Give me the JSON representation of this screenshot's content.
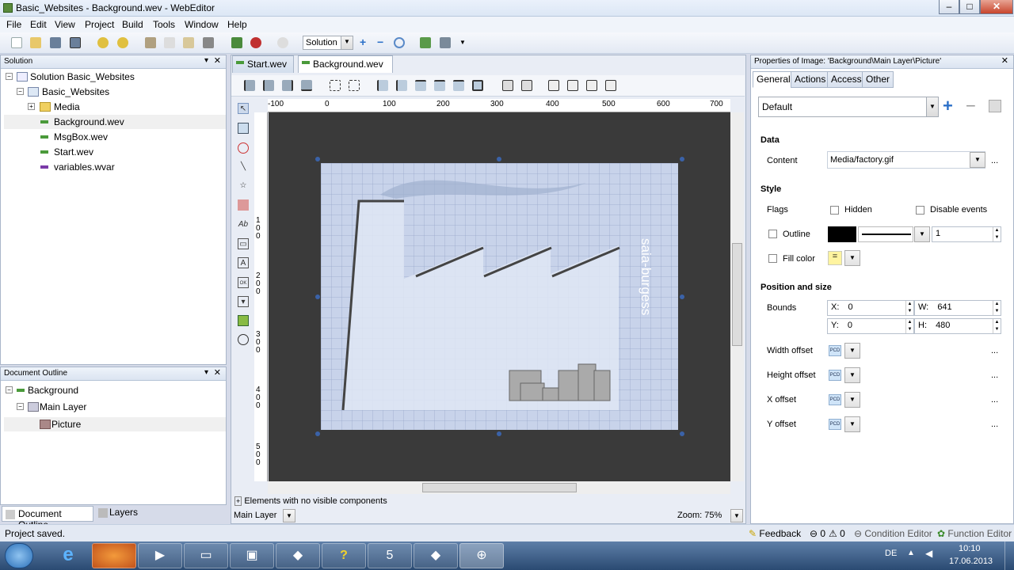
{
  "window": {
    "title": "Basic_Websites - Background.wev - WebEditor",
    "minimize": "‒",
    "maximize": "□",
    "close": "✕"
  },
  "menu": [
    "File",
    "Edit",
    "View",
    "Project",
    "Build",
    "Tools",
    "Window",
    "Help"
  ],
  "toolbar": {
    "config_value": "Solution"
  },
  "solution": {
    "header": "Solution",
    "pin": "▾",
    "close": "✕",
    "items": [
      "Solution Basic_Websites",
      "Basic_Websites",
      "Media",
      "Background.wev",
      "MsgBox.wev",
      "Start.wev",
      "variables.wvar"
    ]
  },
  "outline": {
    "header": "Document Outline",
    "pin": "▾",
    "close": "✕",
    "items": [
      "Background",
      "Main Layer",
      "Picture"
    ],
    "tab_outline": "Document Outline",
    "tab_layers": "Layers"
  },
  "editor": {
    "tabs": [
      "Start.wev",
      "Background.wev"
    ],
    "tab_close": "✕",
    "ruler_h": [
      "-100",
      "0",
      "100",
      "200",
      "300",
      "400",
      "500",
      "600",
      "700"
    ],
    "ruler_v": [
      "1\n0\n0",
      "2\n0\n0",
      "3\n0\n0",
      "4\n0\n0",
      "5\n0\n0"
    ],
    "logo_text": "saia-burgess",
    "hidden_elements": "Elements with no visible components",
    "layer": "Main Layer",
    "zoom": "Zoom: 75%"
  },
  "properties": {
    "header": "Properties of Image: 'Background\\Main Layer\\Picture'",
    "close": "✕",
    "tabs": [
      "General",
      "Actions",
      "Access",
      "Other"
    ],
    "style_select": "Default",
    "section_data": "Data",
    "content_label": "Content",
    "content_value": "Media/factory.gif",
    "section_style": "Style",
    "flags_label": "Flags",
    "hidden_label": "Hidden",
    "disable_label": "Disable events",
    "outline_label": "Outline",
    "outline_width": "1",
    "outline_color": "#000000",
    "fill_label": "Fill color",
    "section_pos": "Position and size",
    "bounds_label": "Bounds",
    "x_label": "X:",
    "x_value": "0",
    "w_label": "W:",
    "w_value": "641",
    "y_label": "Y:",
    "y_value": "0",
    "h_label": "H:",
    "h_value": "480",
    "width_offset": "Width offset",
    "height_offset": "Height offset",
    "x_offset": "X offset",
    "y_offset": "Y offset",
    "pcd": "PCD",
    "more": "..."
  },
  "status": {
    "text": "Project saved.",
    "feedback": "Feedback",
    "errors": "0",
    "warnings": "0",
    "condition_editor": "Condition Editor",
    "function_editor": "Function Editor"
  },
  "taskbar": {
    "lang": "DE",
    "time": "10:10",
    "date": "17.06.2013"
  }
}
